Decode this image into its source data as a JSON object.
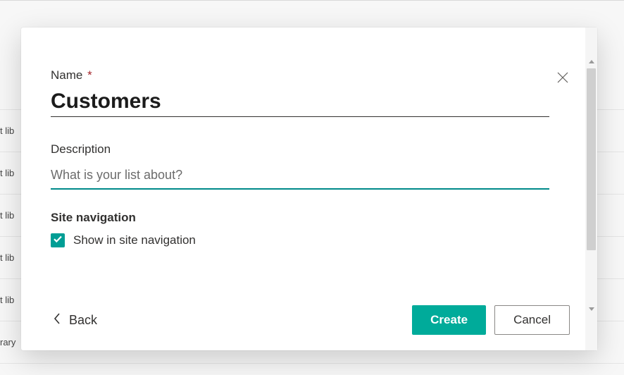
{
  "background": {
    "row_fragments": [
      "t lib",
      "t lib",
      "t lib",
      "t lib",
      "t lib",
      "rary"
    ]
  },
  "dialog": {
    "name": {
      "label": "Name",
      "required_marker": "*",
      "value": "Customers"
    },
    "description": {
      "label": "Description",
      "placeholder": "What is your list about?",
      "value": ""
    },
    "site_navigation": {
      "label": "Site navigation",
      "checkbox_label": "Show in site navigation",
      "checked": true
    },
    "buttons": {
      "back": "Back",
      "create": "Create",
      "cancel": "Cancel"
    }
  }
}
